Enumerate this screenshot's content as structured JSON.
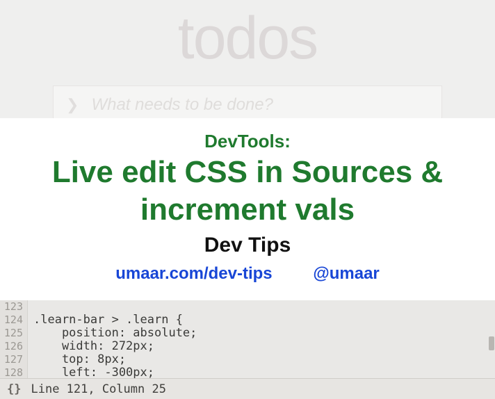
{
  "bg": {
    "app_title": "todos",
    "input_placeholder": "What needs to be done?"
  },
  "card": {
    "pretitle": "DevTools:",
    "title": "Live edit CSS in Sources & increment vals",
    "subtitle": "Dev Tips",
    "link_site": "umaar.com/dev-tips",
    "link_handle": "@umaar"
  },
  "code": {
    "lines": [
      {
        "num": "123",
        "text": ""
      },
      {
        "num": "124",
        "text": ".learn-bar > .learn {"
      },
      {
        "num": "125",
        "text": "    position: absolute;"
      },
      {
        "num": "126",
        "text": "    width: 272px;"
      },
      {
        "num": "127",
        "text": "    top: 8px;"
      },
      {
        "num": "128",
        "text": "    left: -300px;"
      }
    ],
    "status": "Line 121, Column 25",
    "braces_icon": "{}"
  }
}
